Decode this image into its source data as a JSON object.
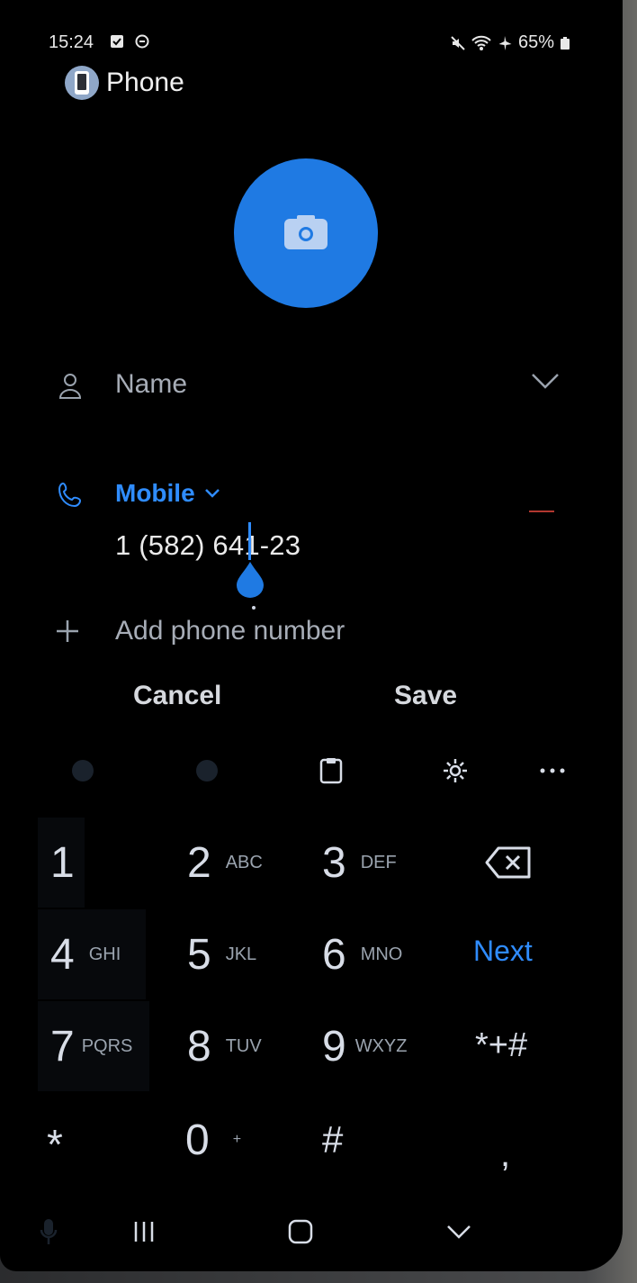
{
  "status_bar": {
    "time": "15:24",
    "battery": "65%"
  },
  "app_bar": {
    "title": "Phone"
  },
  "form": {
    "name_placeholder": "Name",
    "phone_type": "Mobile",
    "phone_value": "1 (582) 641-23",
    "add_phone_label": "Add phone number"
  },
  "actions": {
    "cancel": "Cancel",
    "save": "Save"
  },
  "keyboard": {
    "rows": [
      [
        {
          "digit": "1",
          "letters": ""
        },
        {
          "digit": "2",
          "letters": "ABC"
        },
        {
          "digit": "3",
          "letters": "DEF"
        }
      ],
      [
        {
          "digit": "4",
          "letters": "GHI"
        },
        {
          "digit": "5",
          "letters": "JKL"
        },
        {
          "digit": "6",
          "letters": "MNO"
        }
      ],
      [
        {
          "digit": "7",
          "letters": "PQRS"
        },
        {
          "digit": "8",
          "letters": "TUV"
        },
        {
          "digit": "9",
          "letters": "WXYZ"
        }
      ]
    ],
    "next_label": "Next",
    "symbols_label": "*+#",
    "bottom": {
      "star": "*",
      "zero": "0",
      "plus_hint": "+",
      "hash": "#",
      "comma": ","
    }
  },
  "colors": {
    "accent": "#2f8cff",
    "avatar": "#1f7ae3",
    "background": "#000000"
  }
}
